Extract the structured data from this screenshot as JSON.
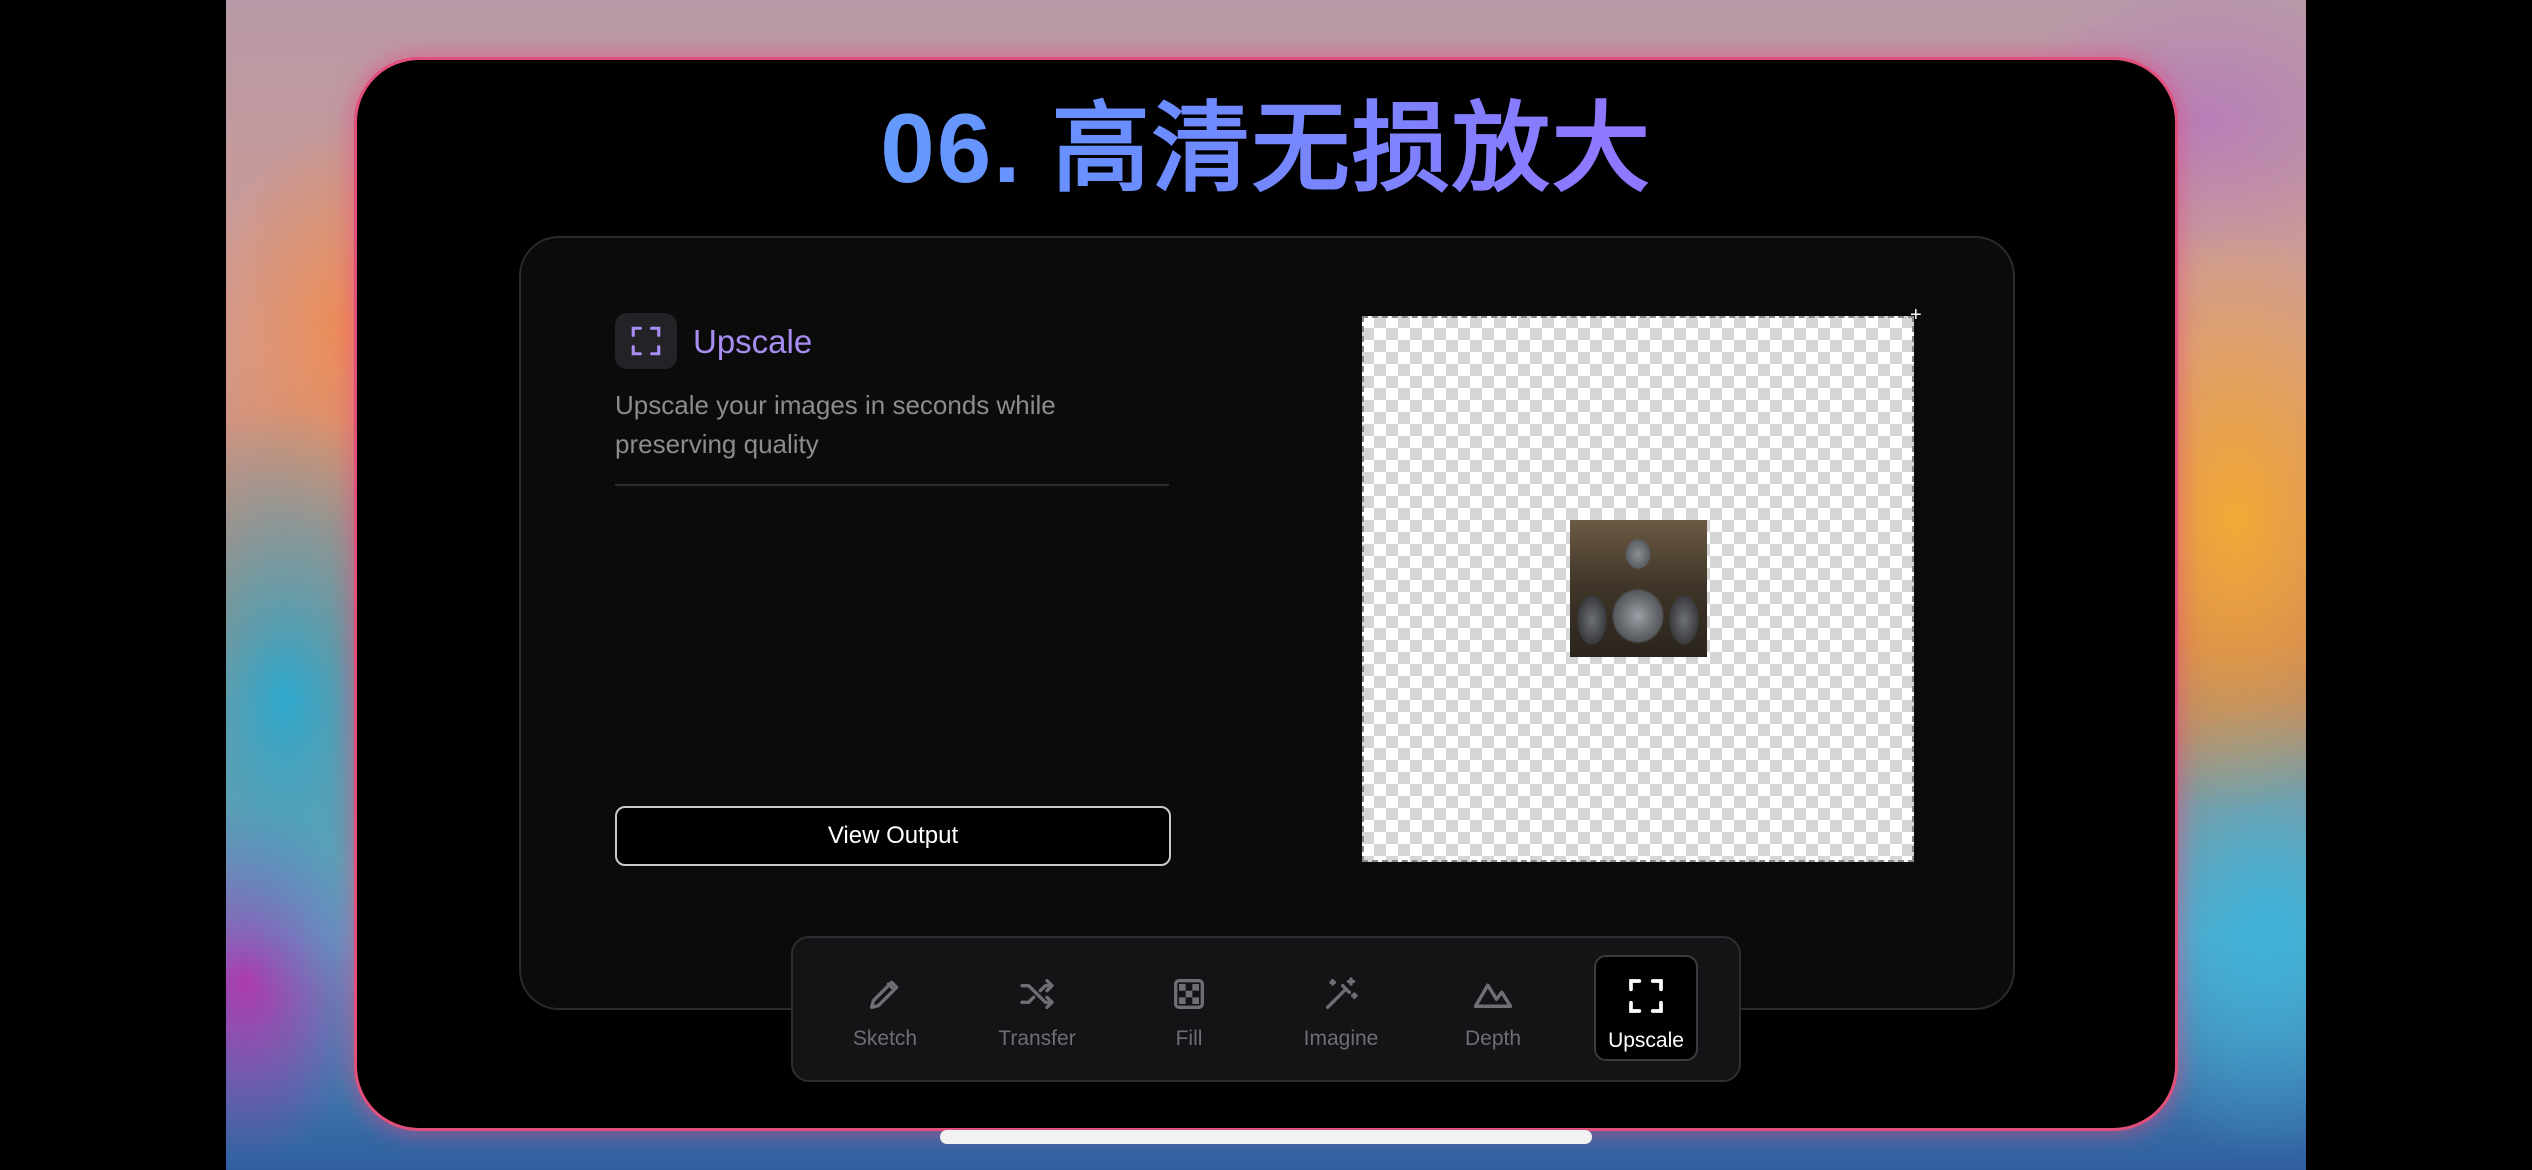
{
  "headline": "06. 高清无损放大",
  "panel": {
    "tool_title": "Upscale",
    "tool_description": "Upscale your images in seconds while preserving quality",
    "view_output_label": "View Output",
    "tool_icon": "expand-corners-icon"
  },
  "canvas": {
    "background": "transparent-checkerboard",
    "image_subject": "armored-knight-thumbnail"
  },
  "toolbar": {
    "items": [
      {
        "label": "Sketch",
        "icon": "pencil-icon",
        "active": false
      },
      {
        "label": "Transfer",
        "icon": "shuffle-icon",
        "active": false
      },
      {
        "label": "Fill",
        "icon": "checker-grid-icon",
        "active": false
      },
      {
        "label": "Imagine",
        "icon": "magic-wand-icon",
        "active": false
      },
      {
        "label": "Depth",
        "icon": "mountain-icon",
        "active": false
      },
      {
        "label": "Upscale",
        "icon": "expand-corners-icon",
        "active": true
      }
    ]
  },
  "colors": {
    "accent_purple": "#a88df2",
    "frame_glow": "#e0507a",
    "headline_gradient_start": "#4fc3f7",
    "headline_gradient_end": "#c04dff"
  }
}
